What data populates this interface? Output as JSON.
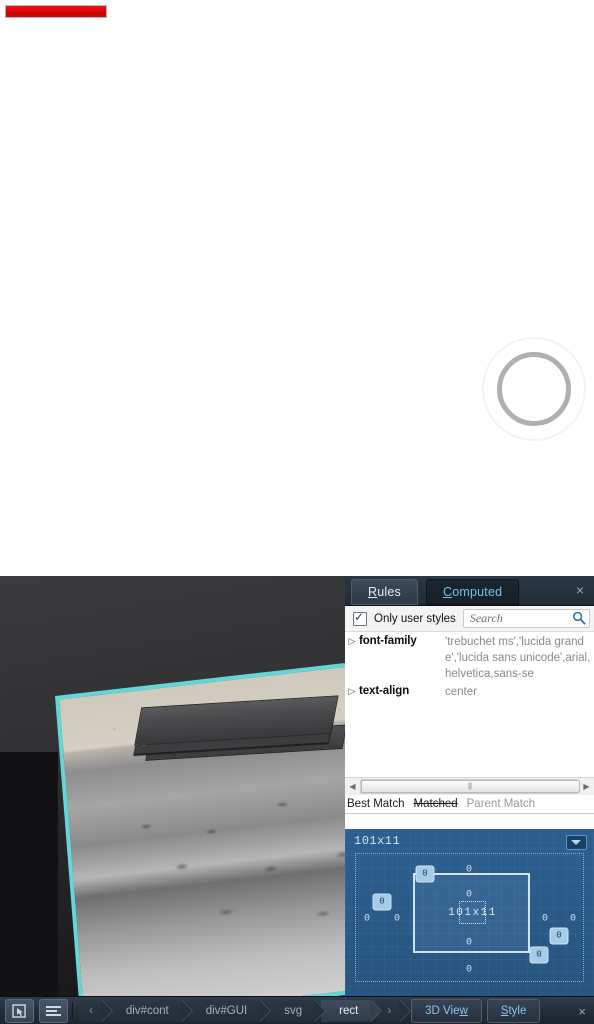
{
  "page": {
    "progress": {
      "label": "loading-progress-bar",
      "percent": 100,
      "fill_color": "#dd0000",
      "border_color": "#b4b4b4"
    },
    "spinner": {
      "label": "loading-spinner",
      "outer_color": "#f3f3f3",
      "inner_color": "#b0b0b0"
    }
  },
  "viewport": {
    "name": "3D WebGL game viewport",
    "highlight_color": "#63d6d9",
    "background_color": "#1d1d1f"
  },
  "devtools": {
    "tabs": [
      {
        "id": "rules",
        "label": "Rules",
        "accel": "R",
        "rest": "ules",
        "active": false
      },
      {
        "id": "computed",
        "label": "Computed",
        "accel": "C",
        "rest": "omputed",
        "active": true
      }
    ],
    "close_label": "×",
    "filter": {
      "checkbox_label": "Only user styles",
      "checkbox_checked": true,
      "search_placeholder": "Search",
      "search_value": ""
    },
    "properties": [
      {
        "name": "font-family",
        "value": "'trebuchet ms','lucida grande','lucida sans unicode',arial,helvetica,sans-se",
        "expanded": false
      },
      {
        "name": "text-align",
        "value": "center",
        "expanded": false
      }
    ],
    "match_filters": [
      {
        "label": "Best Match",
        "state": "normal"
      },
      {
        "label": "Matched",
        "state": "struck"
      },
      {
        "label": "Parent Match",
        "state": "dim"
      }
    ],
    "box_model": {
      "title": "101x11",
      "content_label": "101x11",
      "margin": {
        "top": "0",
        "right": "0",
        "bottom": "0",
        "left": "0"
      },
      "border": {
        "top": "0",
        "right": "0",
        "bottom": "0",
        "left": "0"
      },
      "padding": {
        "top": "0",
        "right": "0",
        "bottom": "0",
        "left": "0"
      },
      "accent_color": "#2d5f91"
    }
  },
  "toolbar": {
    "pick_element_label": "Pick an element",
    "options_label": "Toolbox options",
    "scroll_back_label": "‹",
    "scroll_forward_label": "›",
    "breadcrumbs": [
      {
        "label": "div#cont",
        "selected": false
      },
      {
        "label": "div#GUI",
        "selected": false
      },
      {
        "label": "svg",
        "selected": false
      },
      {
        "label": "rect",
        "selected": true
      }
    ],
    "panel_buttons": [
      {
        "label": "3D View",
        "accel_index": 6,
        "pre": "3D Vie",
        "accel": "w",
        "post": ""
      },
      {
        "label": "Style",
        "accel_index": 1,
        "pre": "",
        "accel": "S",
        "post": "tyle"
      }
    ],
    "close_label": "×"
  }
}
